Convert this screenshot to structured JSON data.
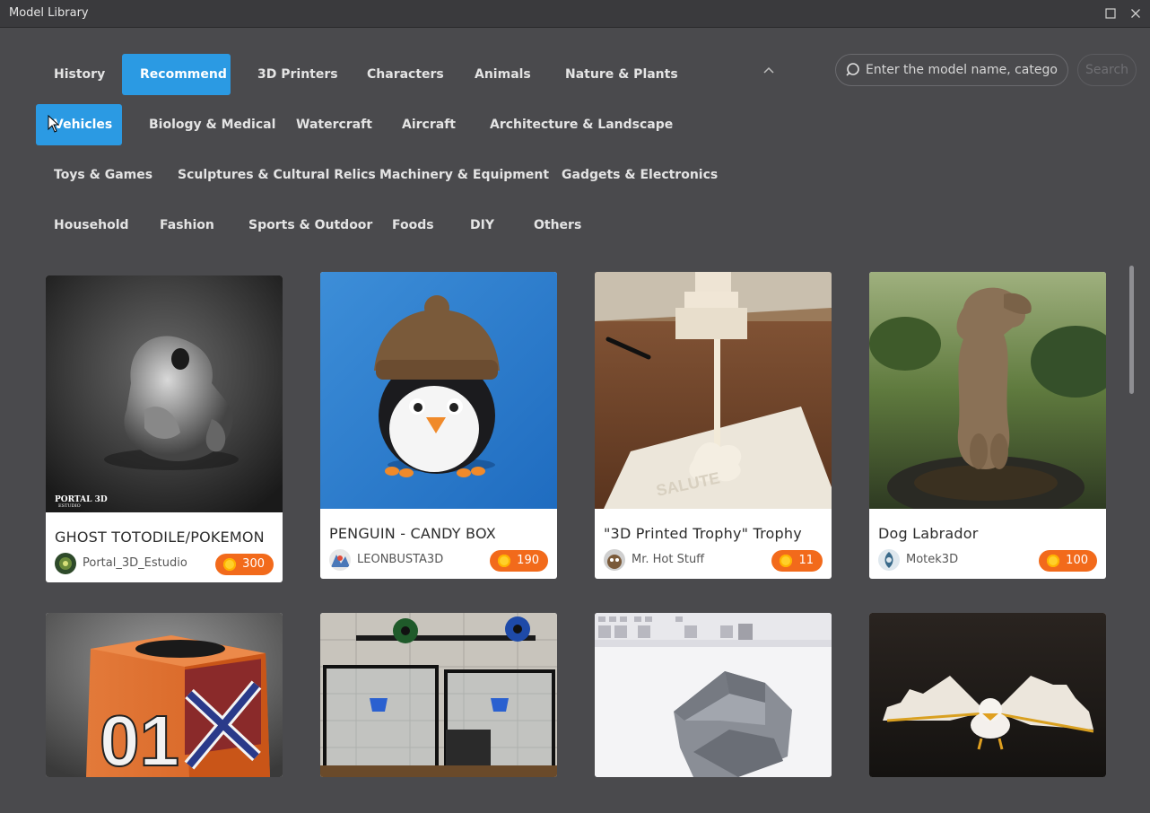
{
  "window": {
    "title": "Model Library"
  },
  "categories": [
    {
      "label": "History"
    },
    {
      "label": "Recommend"
    },
    {
      "label": "3D Printers"
    },
    {
      "label": "Characters"
    },
    {
      "label": "Animals"
    },
    {
      "label": "Nature & Plants"
    },
    {
      "label": "Vehicles"
    },
    {
      "label": "Biology & Medical"
    },
    {
      "label": "Watercraft"
    },
    {
      "label": "Aircraft"
    },
    {
      "label": "Architecture & Landscape"
    },
    {
      "label": "Toys & Games"
    },
    {
      "label": "Sculptures & Cultural Relics"
    },
    {
      "label": "Machinery & Equipment"
    },
    {
      "label": "Gadgets & Electronics"
    },
    {
      "label": "Household"
    },
    {
      "label": "Fashion"
    },
    {
      "label": "Sports & Outdoor"
    },
    {
      "label": "Foods"
    },
    {
      "label": "DIY"
    },
    {
      "label": "Others"
    }
  ],
  "active_category": "Recommend",
  "hovered_category": "Vehicles",
  "search": {
    "placeholder": "Enter the model name, category",
    "value": "",
    "button_label": "Search"
  },
  "models": [
    {
      "title": "GHOST TOTODILE/POKEMON",
      "author": "Portal_3D_Estudio",
      "price": "300",
      "image_text": "PORTAL 3D",
      "image_subtext": "ESTUDIO"
    },
    {
      "title": "PENGUIN - CANDY BOX",
      "author": "LEONBUSTA3D",
      "price": "190"
    },
    {
      "title": "\"3D Printed Trophy\" Trophy",
      "author": "Mr. Hot Stuff",
      "price": "11"
    },
    {
      "title": "Dog Labrador",
      "author": "Motek3D",
      "price": "100"
    },
    {
      "title": "",
      "author": "",
      "price": "",
      "image_text": "01"
    },
    {
      "title": "",
      "author": "",
      "price": ""
    },
    {
      "title": "",
      "author": "",
      "price": ""
    },
    {
      "title": "",
      "author": "",
      "price": ""
    }
  ],
  "colors": {
    "accent": "#2b9ae3",
    "price_badge": "#f26a1b",
    "background": "#4a4a4d",
    "titlebar": "#3a3a3d"
  },
  "icons": {
    "search": "search-icon",
    "collapse": "chevron-up-icon",
    "maximize": "maximize-icon",
    "close": "close-icon",
    "coin": "coin-icon"
  }
}
